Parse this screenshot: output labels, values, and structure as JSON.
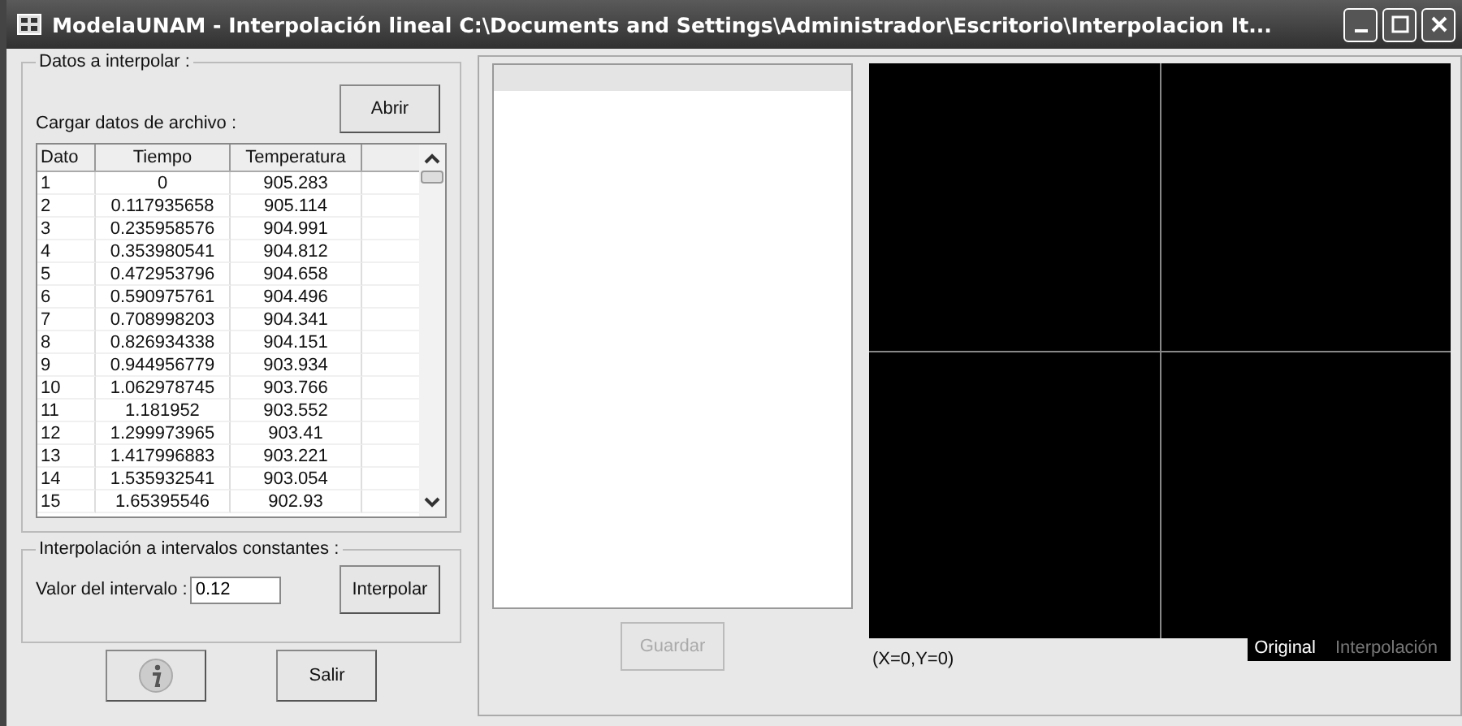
{
  "window": {
    "title": "ModelaUNAM - Interpolación lineal C:\\Documents and Settings\\Administrador\\Escritorio\\Interpolacion It..."
  },
  "data_group": {
    "title": "Datos a interpolar :",
    "load_label": "Cargar datos de archivo :",
    "open_button": "Abrir",
    "table": {
      "columns": [
        "Dato",
        "Tiempo",
        "Temperatura"
      ],
      "rows": [
        [
          "1",
          "0",
          "905.283"
        ],
        [
          "2",
          "0.117935658",
          "905.114"
        ],
        [
          "3",
          "0.235958576",
          "904.991"
        ],
        [
          "4",
          "0.353980541",
          "904.812"
        ],
        [
          "5",
          "0.472953796",
          "904.658"
        ],
        [
          "6",
          "0.590975761",
          "904.496"
        ],
        [
          "7",
          "0.708998203",
          "904.341"
        ],
        [
          "8",
          "0.826934338",
          "904.151"
        ],
        [
          "9",
          "0.944956779",
          "903.934"
        ],
        [
          "10",
          "1.062978745",
          "903.766"
        ],
        [
          "11",
          "1.181952",
          "903.552"
        ],
        [
          "12",
          "1.299973965",
          "903.41"
        ],
        [
          "13",
          "1.417996883",
          "903.221"
        ],
        [
          "14",
          "1.535932541",
          "903.054"
        ],
        [
          "15",
          "1.65395546",
          "902.93"
        ]
      ]
    }
  },
  "interval_group": {
    "title": "Interpolación a intervalos constantes :",
    "label": "Valor del intervalo :",
    "value": "0.12",
    "button": "Interpolar"
  },
  "exit_button": "Salir",
  "save_button": {
    "label": "Guardar",
    "disabled": true
  },
  "plot": {
    "coordinates": "(X=0,Y=0)",
    "legend": [
      {
        "label": "Original",
        "active": true
      },
      {
        "label": "Interpolación",
        "active": false
      }
    ]
  }
}
